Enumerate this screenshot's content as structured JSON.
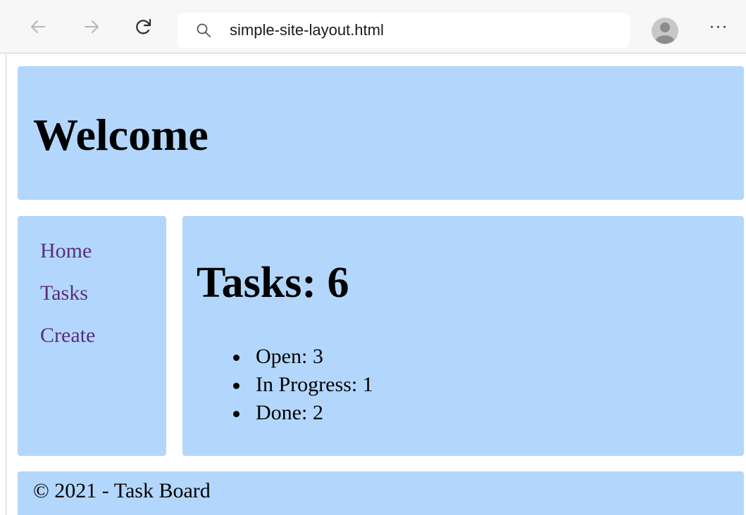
{
  "browser": {
    "address": "simple-site-layout.html",
    "icons": {
      "back": "arrow-left-icon",
      "forward": "arrow-right-icon",
      "reload": "reload-icon",
      "search": "search-icon",
      "profile": "user-avatar-icon",
      "menu": "more-horizontal-icon"
    },
    "menu_label": "···"
  },
  "header": {
    "title": "Welcome"
  },
  "sidebar": {
    "items": [
      {
        "label": "Home"
      },
      {
        "label": "Tasks"
      },
      {
        "label": "Create"
      }
    ]
  },
  "main": {
    "title": "Tasks: 6",
    "statuses": [
      {
        "text": "Open: 3"
      },
      {
        "text": "In Progress: 1"
      },
      {
        "text": "Done: 2"
      }
    ]
  },
  "footer": {
    "text": "© 2021 - Task Board"
  },
  "colors": {
    "panel": "#b3d7fc",
    "link": "#5a2c82",
    "chrome": "#f7f7f7"
  }
}
